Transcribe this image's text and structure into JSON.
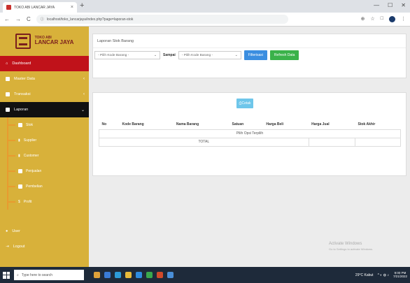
{
  "browser": {
    "tab_title": "TOKO ABI LANCAR JAYA",
    "url": "localhost/toko_lancarjaya/index.php?page=laporan-stok",
    "tab_close": "×",
    "new_tab": "+",
    "win_min": "—",
    "win_max": "☐",
    "win_close": "✕"
  },
  "sidebar": {
    "brand_line1": "TOKO ABI",
    "brand_line2": "LANCAR JAYA",
    "items": [
      {
        "label": "Dashboard"
      },
      {
        "label": "Master Data"
      },
      {
        "label": "Transaksi"
      },
      {
        "label": "Laporan"
      }
    ],
    "sub_items": [
      {
        "label": "Stok"
      },
      {
        "label": "Supplier"
      },
      {
        "label": "Customer"
      },
      {
        "label": "Penjualan"
      },
      {
        "label": "Pembelian"
      },
      {
        "label": "Profit"
      }
    ],
    "bottom_items": [
      {
        "label": "User"
      },
      {
        "label": "Logout"
      }
    ]
  },
  "main": {
    "card_title": "Laporan Stok Barang",
    "select1_placeholder": "- Pilih Kode Barang -",
    "sampai_label": "Sampai",
    "select2_placeholder": "- Pilih Kode Barang -",
    "btn_filter": "Filterisasi",
    "btn_refresh": "Refresh Data",
    "btn_cetak": "Cetak",
    "table": {
      "headers": [
        "No",
        "Kode Barang",
        "Nama Barang",
        "Satuan",
        "Harga Beli",
        "Harga Jual",
        "Stok Akhir"
      ],
      "empty_msg": "Pilih Opsi Terpilih",
      "total_label": "TOTAL"
    }
  },
  "watermark": {
    "line1": "Activate Windows",
    "line2": "Go to Settings to activate Windows."
  },
  "taskbar": {
    "search_placeholder": "Type here to search",
    "weather": "29°C Kabut",
    "time": "9:00 PM",
    "date": "7/21/2022"
  }
}
